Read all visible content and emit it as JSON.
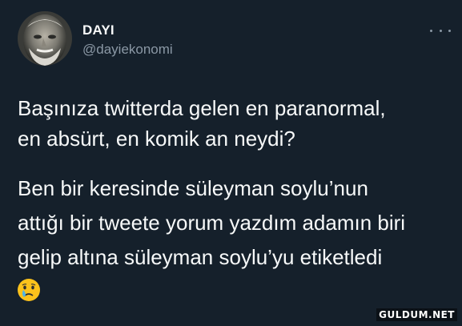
{
  "tweet": {
    "author": {
      "display_name": "DAYI",
      "handle": "@dayiekonomi",
      "avatar_icon": "elderly-man-avatar"
    },
    "more_icon": "more-options-icon",
    "question": "Başınıza twitterda gelen en paranormal,\nen absürt, en komik an neydi?",
    "answer": "Ben bir keresinde süleyman soylu’nun\nattığı bir tweete yorum yazdım adamın biri\ngelip altına süleyman soylu’yu etiketledi",
    "emoji": "crying-face-emoji"
  },
  "watermark": "GULDUM.NET",
  "colors": {
    "background": "#15202b",
    "text": "#f7f9f9",
    "secondary_text": "#8b98a5"
  }
}
